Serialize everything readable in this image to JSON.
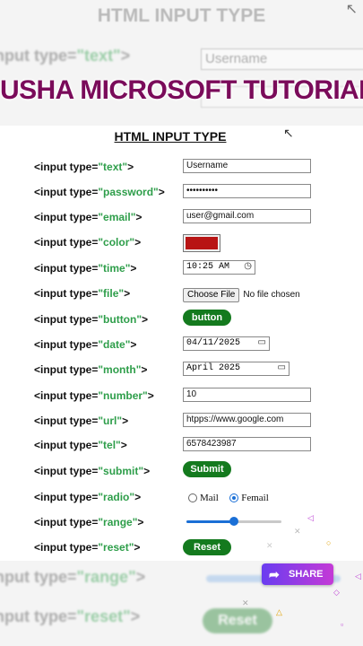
{
  "background": {
    "title": "HTML INPUT TYPE",
    "rows": [
      {
        "prefix": "nput type=",
        "value": "\"text\"",
        "suffix": ">",
        "input": "Username"
      },
      {
        "prefix": "nput type=",
        "value": "\"range\"",
        "suffix": ">"
      },
      {
        "prefix": "nput type=",
        "value": "\"reset\"",
        "suffix": ">",
        "button": "Reset"
      }
    ]
  },
  "overlay_title": "USHA MICROSOFT TUTORIAL",
  "card": {
    "title": "HTML INPUT TYPE",
    "rows": [
      {
        "pre": "<input type=",
        "type": "\"text\"",
        "post": ">",
        "value": "Username"
      },
      {
        "pre": "<input type=",
        "type": "\"password\"",
        "post": ">",
        "value": "••••••••••"
      },
      {
        "pre": "<input type=",
        "type": "\"email\"",
        "post": ">",
        "value": "user@gmail.com"
      },
      {
        "pre": "<input type=",
        "type": "\"color\"",
        "post": ">",
        "color": "#b81414"
      },
      {
        "pre": "<input type=",
        "type": "\"time\"",
        "post": ">",
        "value": "10:25 AM"
      },
      {
        "pre": "<input type=",
        "type": "\"file\"",
        "post": ">",
        "button": "Choose File",
        "status": "No file chosen"
      },
      {
        "pre": "<input type=",
        "type": "\"button\"",
        "post": ">",
        "button": "button"
      },
      {
        "pre": "<input type=",
        "type": "\"date\"",
        "post": ">",
        "value": "04/11/2025"
      },
      {
        "pre": "<input type=",
        "type": "\"month\"",
        "post": ">",
        "value": "April 2025"
      },
      {
        "pre": "<input type=",
        "type": "\"number\"",
        "post": ">",
        "value": "10"
      },
      {
        "pre": "<input type=",
        "type": "\"url\"",
        "post": ">",
        "value": "htpps://www.google.com"
      },
      {
        "pre": "<input type=",
        "type": "\"tel\"",
        "post": ">",
        "value": "6578423987"
      },
      {
        "pre": "<input type=",
        "type": "\"submit\"",
        "post": ">",
        "button": "Submit"
      },
      {
        "pre": "<input type=",
        "type": "\"radio\"",
        "post": ">",
        "options": [
          "Mail",
          "Femail"
        ],
        "selected": "Femail"
      },
      {
        "pre": "<input type=",
        "type": "\"range\"",
        "post": ">",
        "range_fraction": 0.5
      },
      {
        "pre": "<input type=",
        "type": "\"reset\"",
        "post": ">",
        "button": "Reset"
      }
    ]
  },
  "share": {
    "label": "SHARE",
    "icon": "share-arrow-icon"
  },
  "colors": {
    "accent_green": "#2e9e4a",
    "button_green": "#147a1e",
    "title_purple": "#7a0b5a",
    "radio_blue": "#1a6fd6"
  }
}
